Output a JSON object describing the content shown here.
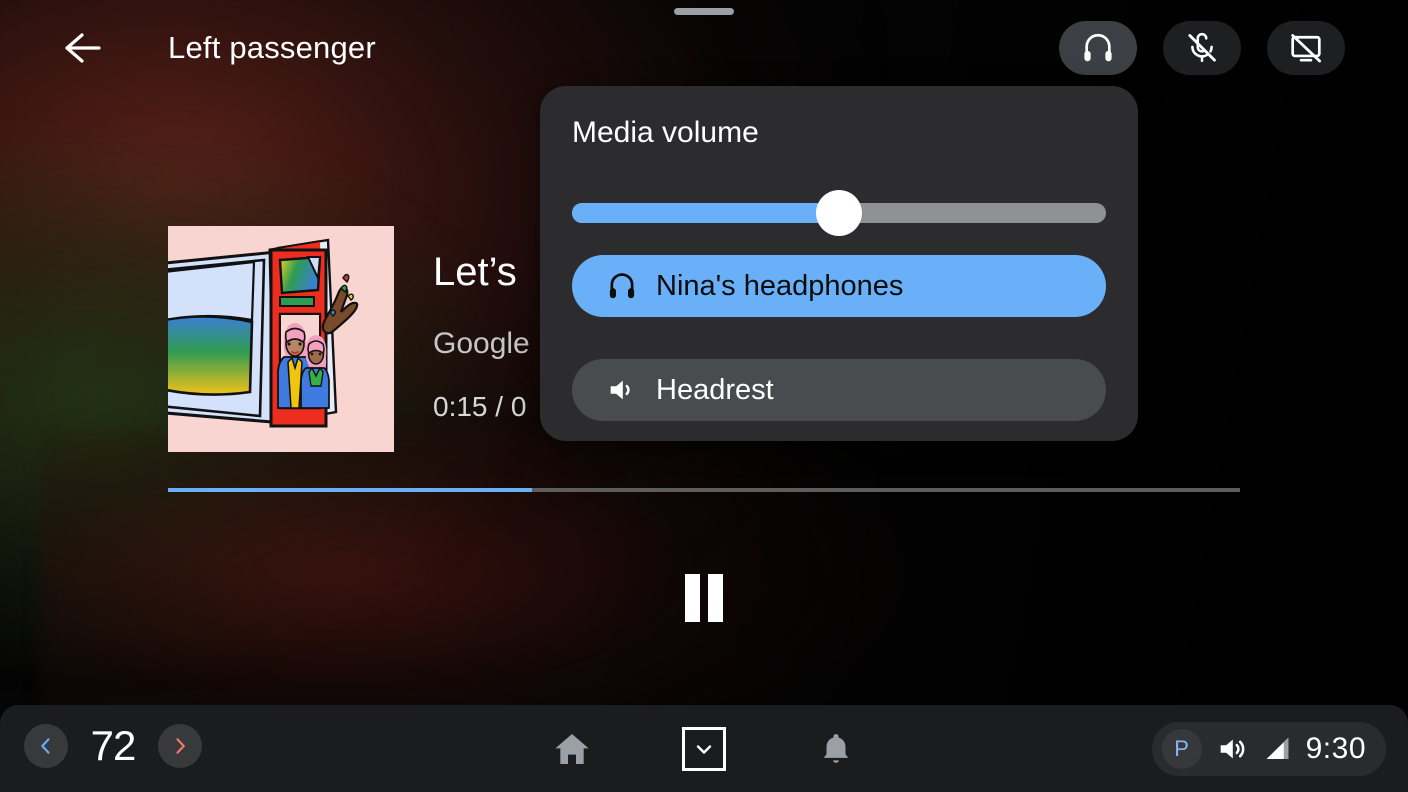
{
  "header": {
    "back_icon": "arrow-left-icon",
    "title": "Left passenger",
    "buttons": [
      {
        "name": "headphones",
        "icon": "headphones-icon",
        "active": true
      },
      {
        "name": "microphone-off",
        "icon": "mic-off-icon",
        "active": false
      },
      {
        "name": "screen-off",
        "icon": "screen-off-icon",
        "active": false
      }
    ]
  },
  "media": {
    "title": "Let’s",
    "artist": "Google",
    "time": "0:15 / 0",
    "progress_percent": 34,
    "transport": {
      "state": "playing",
      "button": "pause-button"
    },
    "album_art": {
      "alt": "Illustration of two people holding a red magazine",
      "background": "#f9d5d2"
    }
  },
  "volume_panel": {
    "label": "Media volume",
    "slider": {
      "value_percent": 50,
      "fill_color": "#6ab0f8",
      "track_color": "#8e9194"
    },
    "devices": [
      {
        "label": "Nina's headphones",
        "icon": "headphones-icon",
        "selected": true,
        "color": "#6ab0f8"
      },
      {
        "label": "Headrest",
        "icon": "speaker-icon",
        "selected": false,
        "color": "#494c4f"
      }
    ]
  },
  "system_bar": {
    "temperature": {
      "value": "72",
      "decrease_icon": "chevron-left-icon",
      "increase_icon": "chevron-right-icon"
    },
    "nav": [
      {
        "name": "home",
        "icon": "home-icon"
      },
      {
        "name": "hide-panel",
        "icon": "chevron-down-box-icon"
      },
      {
        "name": "notifications",
        "icon": "bell-icon"
      }
    ],
    "status": {
      "gear": "P",
      "gear_color": "#8ab4f8",
      "volume_icon": "volume-icon",
      "signal_icon": "signal-icon",
      "clock": "9:30"
    }
  }
}
